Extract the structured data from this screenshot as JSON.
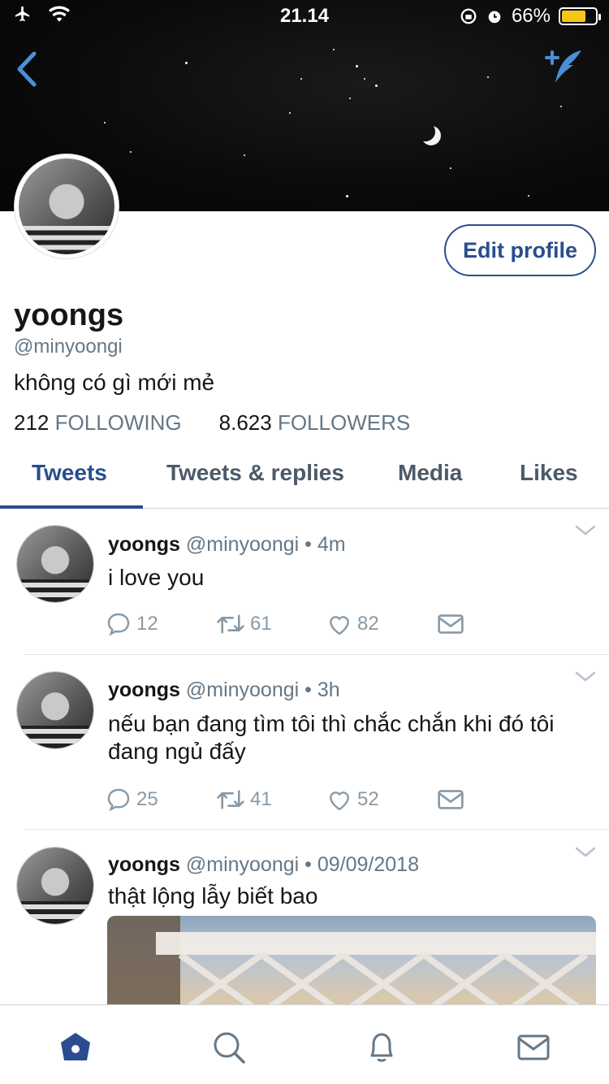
{
  "status": {
    "time": "21.14",
    "battery": "66%"
  },
  "profile": {
    "name": "yoongs",
    "handle": "@minyoongi",
    "bio": "không có gì mới mẻ",
    "following_count": "212",
    "following_label": "FOLLOWING",
    "followers_count": "8.623",
    "followers_label": "FOLLOWERS",
    "edit_label": "Edit profile"
  },
  "tabs": [
    "Tweets",
    "Tweets & replies",
    "Media",
    "Likes"
  ],
  "tweets": [
    {
      "name": "yoongs",
      "handle": "@minyoongi",
      "time": "4m",
      "text": "i love you",
      "replies": "12",
      "retweets": "61",
      "likes": "82"
    },
    {
      "name": "yoongs",
      "handle": "@minyoongi",
      "time": "3h",
      "text": "nếu bạn đang tìm tôi thì chắc chắn khi đó tôi đang ngủ đấy",
      "replies": "25",
      "retweets": "41",
      "likes": "52"
    },
    {
      "name": "yoongs",
      "handle": "@minyoongi",
      "time": "09/09/2018",
      "text": "thật lộng lẫy biết bao"
    }
  ],
  "icons": {
    "back": "chevron-left-icon",
    "compose": "compose-tweet-icon",
    "reply": "reply-icon",
    "retweet": "retweet-icon",
    "like": "heart-icon",
    "dm": "envelope-icon",
    "home": "home-icon",
    "search": "search-icon",
    "notifications": "bell-icon",
    "messages": "mail-icon"
  },
  "colors": {
    "accent": "#2b4d8f",
    "icon_blue": "#4a90d9",
    "muted": "#657786",
    "battery": "#f5c518"
  }
}
